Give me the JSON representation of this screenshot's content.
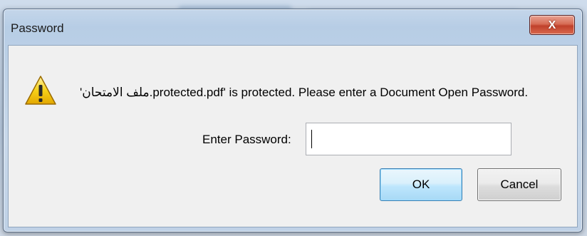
{
  "window": {
    "title": "Password",
    "close_label": "X"
  },
  "dialog": {
    "message": "'ملف الامتحان.protected.pdf' is protected. Please enter a Document Open Password.",
    "password_label": "Enter Password:",
    "password_value": "",
    "ok_label": "OK",
    "cancel_label": "Cancel"
  },
  "icons": {
    "warning": "warning-icon",
    "close": "close-icon"
  },
  "colors": {
    "ok_border": "#3c7fb1",
    "close_red": "#c0412b",
    "warning_yellow": "#f5c800"
  }
}
